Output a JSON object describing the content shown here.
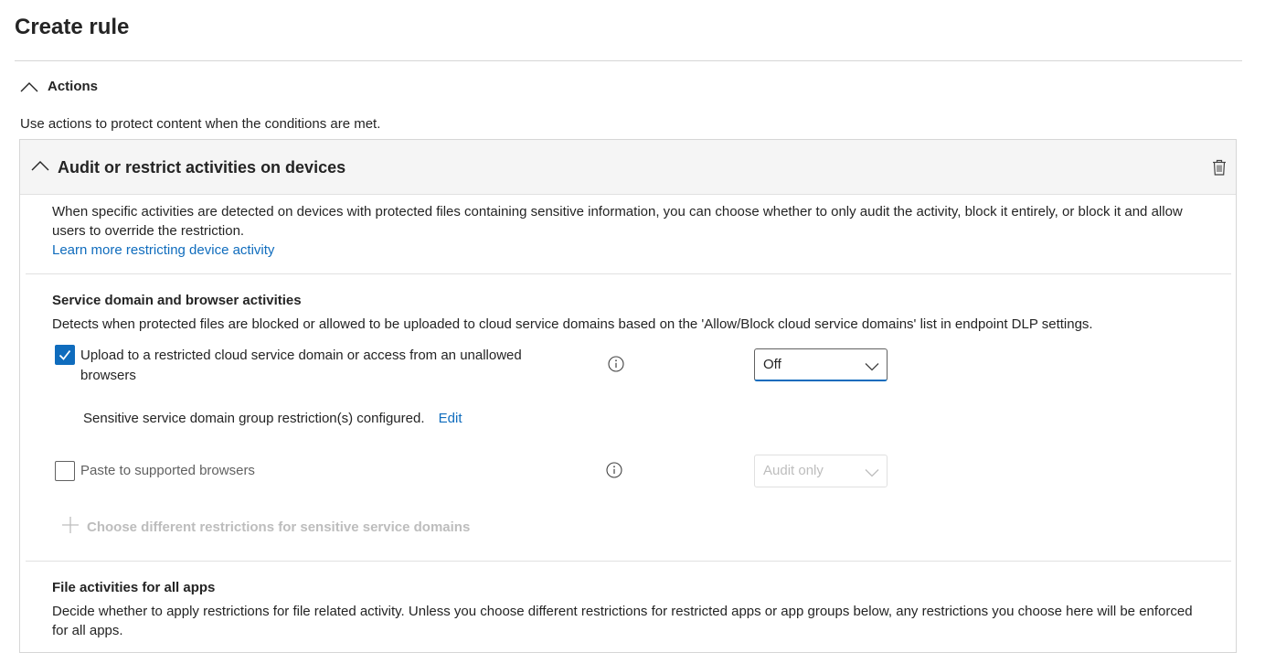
{
  "page": {
    "title": "Create rule"
  },
  "actions": {
    "label": "Actions",
    "description": "Use actions to protect content when the conditions are met."
  },
  "card": {
    "title": "Audit or restrict activities on devices",
    "intro": "When specific activities are detected on devices with protected files containing sensitive information, you can choose whether to only audit the activity, block it entirely, or block it and allow users to override the restriction.",
    "learn_more": "Learn more restricting device activity",
    "service_section": {
      "title": "Service domain and browser activities",
      "description": "Detects when protected files are blocked or allowed to be uploaded to cloud service domains based on the 'Allow/Block cloud service domains' list in endpoint DLP settings.",
      "upload": {
        "label": "Upload to a restricted cloud service domain or access from an unallowed browsers",
        "checked": true,
        "select_value": "Off",
        "note": "Sensitive service domain group restriction(s) configured.",
        "edit": "Edit"
      },
      "paste": {
        "label": "Paste to supported browsers",
        "checked": false,
        "select_value": "Audit only"
      },
      "add_link": "Choose different restrictions for sensitive service domains"
    },
    "file_section": {
      "title": "File activities for all apps",
      "description": "Decide whether to apply restrictions for file related activity. Unless you choose different restrictions for restricted apps or app groups below, any restrictions you choose here will be enforced for all apps."
    }
  },
  "colors": {
    "accent": "#0f6cbd",
    "border": "#d6d6d6",
    "header_bg": "#f5f5f5",
    "disabled_text": "#bdbdbd"
  },
  "icons": [
    "chevron-up-icon",
    "trash-icon",
    "info-icon",
    "checkmark-icon",
    "chevron-down-icon",
    "plus-icon"
  ]
}
